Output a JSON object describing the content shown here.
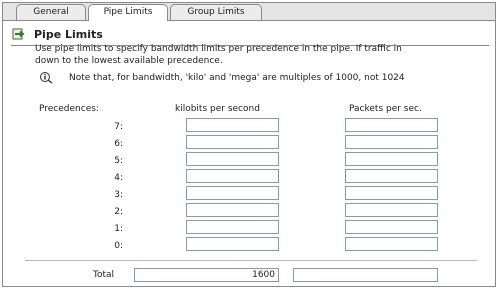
{
  "tabs": [
    {
      "label": "General"
    },
    {
      "label": "Pipe Limits",
      "active": true
    },
    {
      "label": "Group Limits"
    }
  ],
  "section": {
    "title": "Pipe Limits",
    "icon": "pipe-limits-icon"
  },
  "description": {
    "line1": "Use pipe limits to specify bandwidth limits per precedence in the pipe. If traffic in",
    "line2": "down to the lowest available precedence."
  },
  "note": {
    "icon": "info-icon",
    "text": "Note that, for bandwidth, 'kilo' and 'mega' are multiples of 1000, not 1024"
  },
  "columns": {
    "precedence": "Precedences:",
    "kbps": "kilobits per second",
    "pps": "Packets per sec."
  },
  "rows": [
    {
      "label": "7:",
      "kbps": "",
      "pps": ""
    },
    {
      "label": "6:",
      "kbps": "",
      "pps": ""
    },
    {
      "label": "5:",
      "kbps": "",
      "pps": ""
    },
    {
      "label": "4:",
      "kbps": "",
      "pps": ""
    },
    {
      "label": "3:",
      "kbps": "",
      "pps": ""
    },
    {
      "label": "2:",
      "kbps": "",
      "pps": ""
    },
    {
      "label": "1:",
      "kbps": "",
      "pps": ""
    },
    {
      "label": "0:",
      "kbps": "",
      "pps": ""
    }
  ],
  "total": {
    "label": "Total",
    "kbps": "1600",
    "pps": ""
  },
  "colors": {
    "accent": "#2e7d32",
    "input_border": "#7f9db9"
  }
}
